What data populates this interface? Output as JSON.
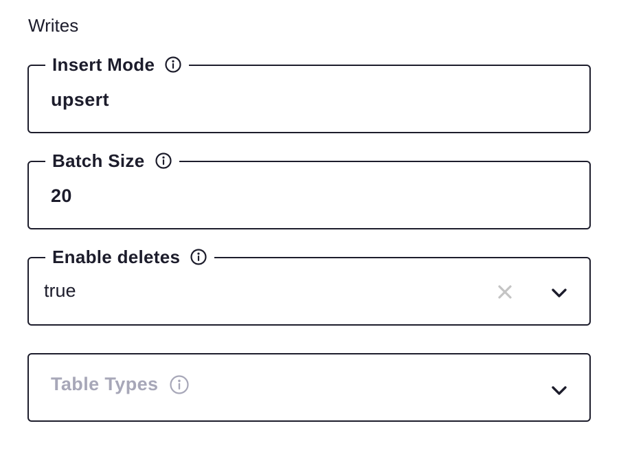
{
  "section": {
    "title": "Writes"
  },
  "fields": {
    "insert_mode": {
      "label": "Insert Mode",
      "value": "upsert",
      "icon": "info-icon"
    },
    "batch_size": {
      "label": "Batch Size",
      "value": "20",
      "icon": "info-icon"
    },
    "enable_deletes": {
      "label": "Enable deletes",
      "value": "true",
      "icon": "info-icon",
      "clear_icon": "close-icon",
      "dropdown_icon": "chevron-down-icon"
    },
    "table_types": {
      "placeholder": "Table Types",
      "icon": "info-icon",
      "dropdown_icon": "chevron-down-icon"
    }
  },
  "colors": {
    "text": "#1c1c2b",
    "border": "#1c1c2b",
    "placeholder": "#a7a7b8",
    "clear_icon": "#c4c4c4",
    "background": "#ffffff"
  }
}
